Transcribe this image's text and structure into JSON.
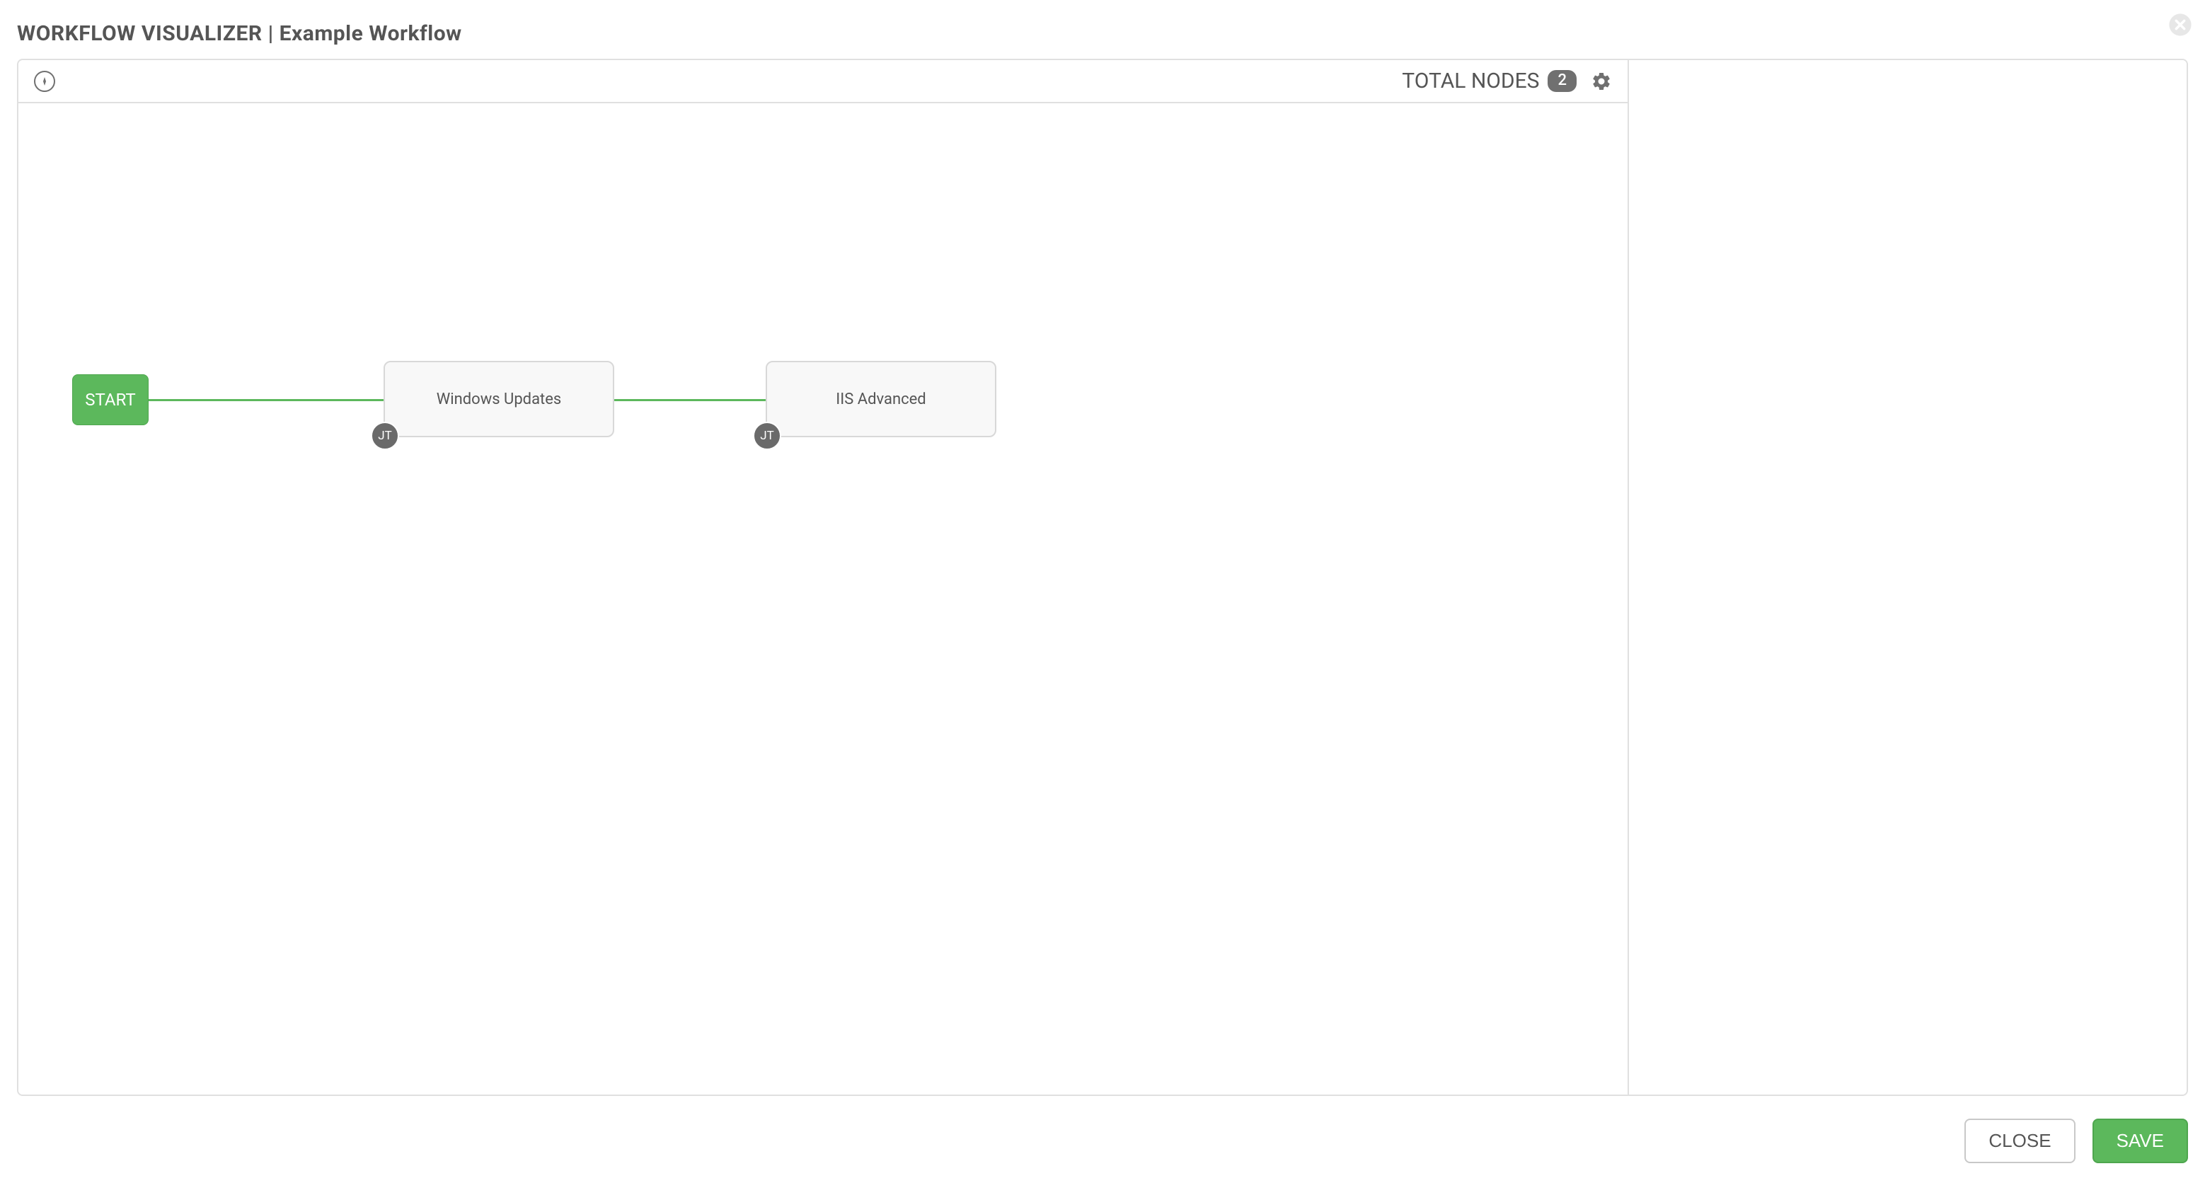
{
  "header": {
    "title_app": "WORKFLOW VISUALIZER",
    "title_sep": " | ",
    "title_name": "Example Workflow"
  },
  "toolbar": {
    "total_label": "TOTAL NODES",
    "total_count": "2"
  },
  "nodes": {
    "start": "START",
    "node1": {
      "label": "Windows Updates",
      "badge": "JT"
    },
    "node2": {
      "label": "IIS Advanced",
      "badge": "JT"
    }
  },
  "footer": {
    "close": "CLOSE",
    "save": "SAVE"
  }
}
